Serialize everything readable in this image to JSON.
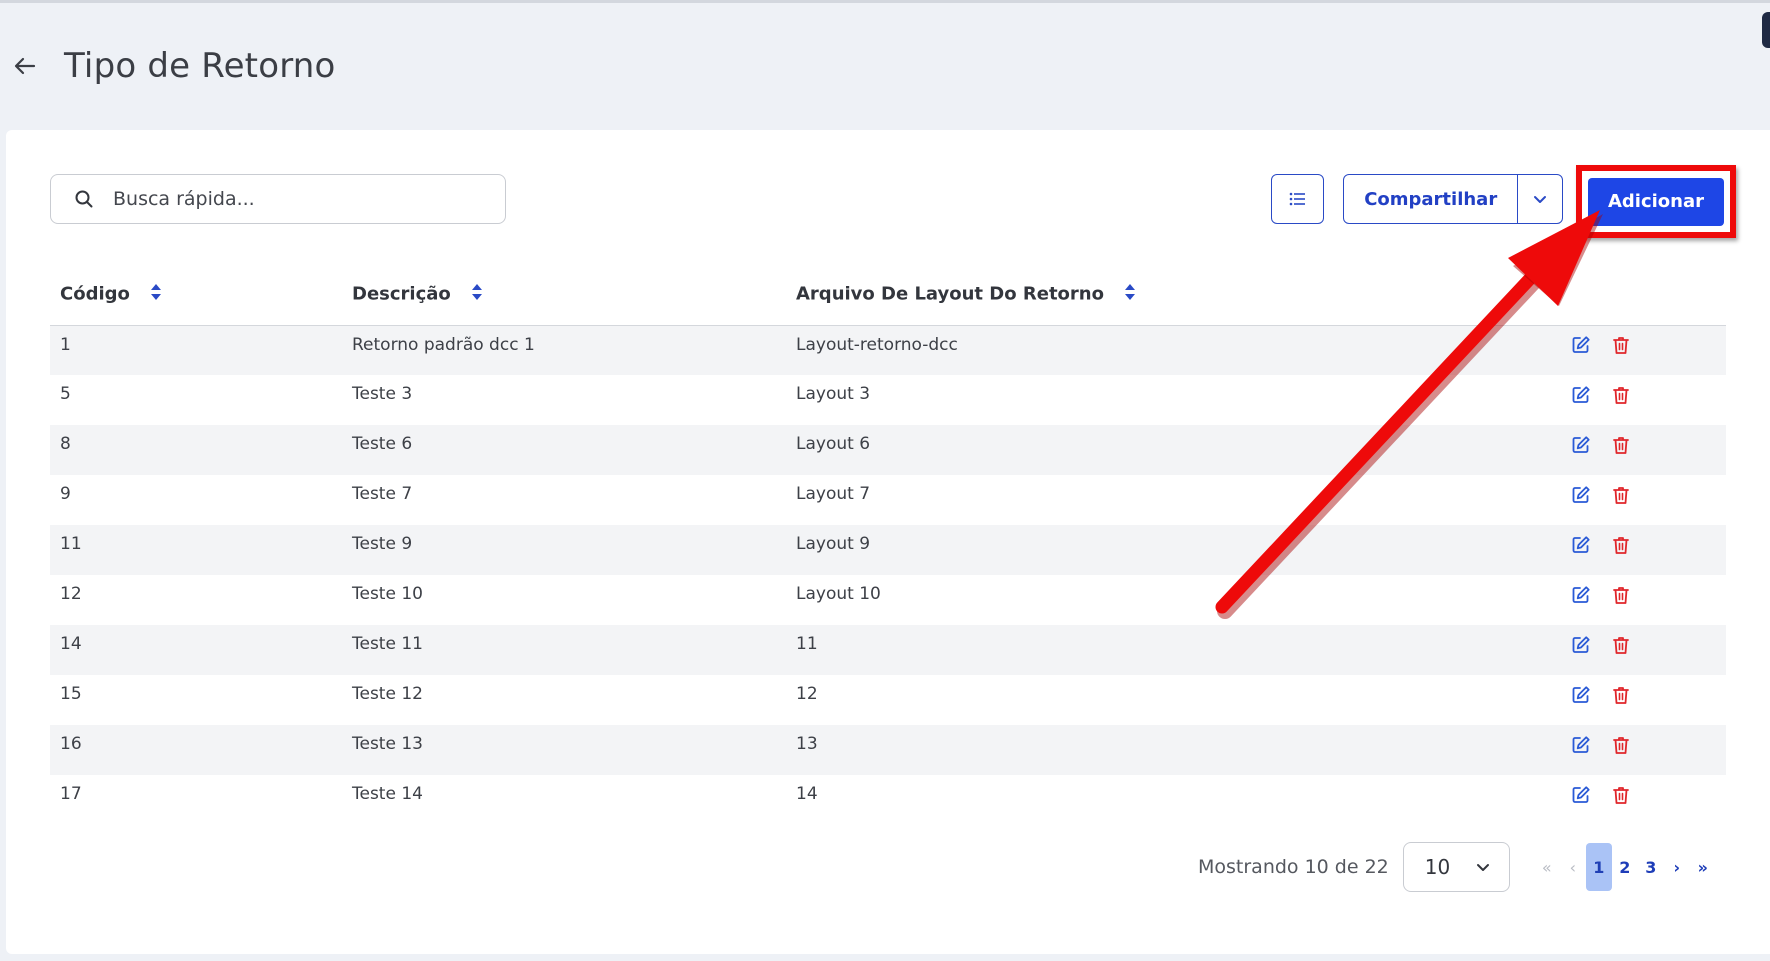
{
  "page": {
    "title": "Tipo de Retorno"
  },
  "toolbar": {
    "search_placeholder": "Busca rápida...",
    "share_label": "Compartilhar",
    "add_label": "Adicionar"
  },
  "table": {
    "headers": {
      "codigo": "Código",
      "descricao": "Descrição",
      "arquivo": "Arquivo De Layout Do Retorno"
    },
    "rows": [
      {
        "codigo": "1",
        "descricao": "Retorno padrão dcc 1",
        "arquivo": "Layout-retorno-dcc"
      },
      {
        "codigo": "5",
        "descricao": "Teste 3",
        "arquivo": "Layout 3"
      },
      {
        "codigo": "8",
        "descricao": "Teste 6",
        "arquivo": "Layout 6"
      },
      {
        "codigo": "9",
        "descricao": "Teste 7",
        "arquivo": "Layout 7"
      },
      {
        "codigo": "11",
        "descricao": "Teste 9",
        "arquivo": "Layout 9"
      },
      {
        "codigo": "12",
        "descricao": "Teste 10",
        "arquivo": "Layout 10"
      },
      {
        "codigo": "14",
        "descricao": "Teste 11",
        "arquivo": "11"
      },
      {
        "codigo": "15",
        "descricao": "Teste 12",
        "arquivo": "12"
      },
      {
        "codigo": "16",
        "descricao": "Teste 13",
        "arquivo": "13"
      },
      {
        "codigo": "17",
        "descricao": "Teste 14",
        "arquivo": "14"
      }
    ]
  },
  "pagination": {
    "info": "Mostrando 10 de 22",
    "page_size": "10",
    "first": "«",
    "prev": "‹",
    "pages": [
      "1",
      "2",
      "3"
    ],
    "next": "›",
    "last": "»",
    "current": "1"
  },
  "colors": {
    "primary": "#1e46e6",
    "link": "#2240c4",
    "danger": "#e0262b",
    "highlight_annotation": "#ee0a0a"
  }
}
